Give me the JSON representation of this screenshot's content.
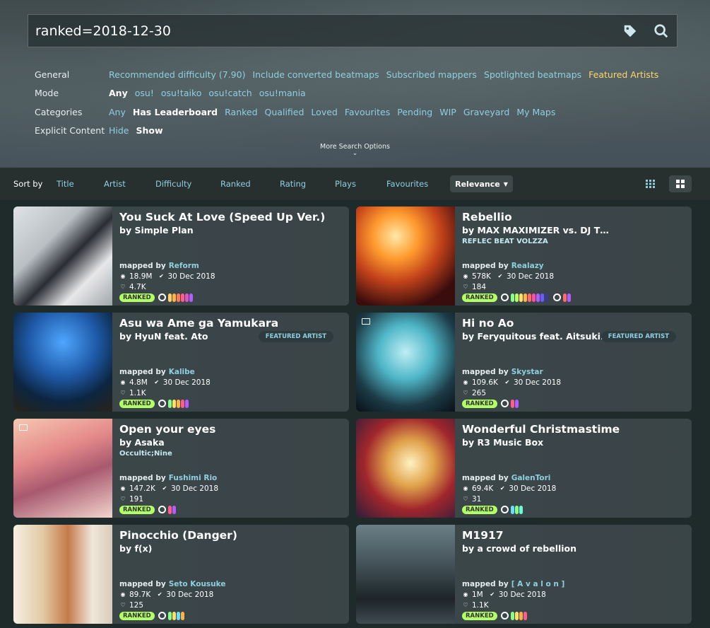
{
  "search": {
    "value": "ranked=2018-12-30"
  },
  "filters": [
    {
      "label": "General",
      "options": [
        {
          "text": "Recommended difficulty (7.90)",
          "state": ""
        },
        {
          "text": "Include converted beatmaps",
          "state": ""
        },
        {
          "text": "Subscribed mappers",
          "state": ""
        },
        {
          "text": "Spotlighted beatmaps",
          "state": ""
        },
        {
          "text": "Featured Artists",
          "state": "featured"
        }
      ]
    },
    {
      "label": "Mode",
      "options": [
        {
          "text": "Any",
          "state": "active"
        },
        {
          "text": "osu!",
          "state": ""
        },
        {
          "text": "osu!taiko",
          "state": ""
        },
        {
          "text": "osu!catch",
          "state": ""
        },
        {
          "text": "osu!mania",
          "state": ""
        }
      ]
    },
    {
      "label": "Categories",
      "options": [
        {
          "text": "Any",
          "state": ""
        },
        {
          "text": "Has Leaderboard",
          "state": "active"
        },
        {
          "text": "Ranked",
          "state": ""
        },
        {
          "text": "Qualified",
          "state": ""
        },
        {
          "text": "Loved",
          "state": ""
        },
        {
          "text": "Favourites",
          "state": ""
        },
        {
          "text": "Pending",
          "state": ""
        },
        {
          "text": "WIP",
          "state": ""
        },
        {
          "text": "Graveyard",
          "state": ""
        },
        {
          "text": "My Maps",
          "state": ""
        }
      ]
    },
    {
      "label": "Explicit Content",
      "options": [
        {
          "text": "Hide",
          "state": ""
        },
        {
          "text": "Show",
          "state": "active"
        }
      ]
    }
  ],
  "more_options": "More Search Options",
  "sort": {
    "label": "Sort by",
    "options": [
      "Title",
      "Artist",
      "Difficulty",
      "Ranked",
      "Rating",
      "Plays",
      "Favourites"
    ],
    "active": "Relevance"
  },
  "ranked_label": "RANKED",
  "mapped_by_label": "mapped by",
  "featured_label": "FEATURED ARTIST",
  "colors": {
    "accent": "#8ecfe0",
    "featured": "#ffd56a",
    "ranked": "#b3ff66"
  },
  "cards": [
    {
      "title": "You Suck At Love (Speed Up Ver.)",
      "artist": "by Simple Plan",
      "source": "",
      "mapper": "Reform",
      "plays": "18.9M",
      "date": "30 Dec 2018",
      "favs": "4.7K",
      "featured": false,
      "thumb_icon": false,
      "thumb": "linear-gradient(135deg,#dfe3e6 0%,#b9c0c4 35%,#2a2d33 55%,#e8e8ea 75%,#9fa6aa 100%)",
      "diffs": [
        [
          "#ffd166",
          "#ffb347",
          "#ff7a59",
          "#ff5d8f",
          "#e055c4",
          "#b35cff"
        ]
      ]
    },
    {
      "title": "Rebellio",
      "artist": "by MAX MAXIMIZER vs. DJ TOTTO",
      "source": "REFLEC BEAT VOLZZA",
      "mapper": "Realazy",
      "plays": "578K",
      "date": "30 Dec 2018",
      "favs": "184",
      "featured": false,
      "thumb_icon": false,
      "thumb": "radial-gradient(circle at 40% 30%,#ffe9a8 0%,#ff9a2e 25%,#c2421a 50%,#3a0d0d 80%)",
      "diffs": [
        [
          "#88ff88",
          "#b8ff66",
          "#ffe066",
          "#ffb347",
          "#ff6b6b",
          "#ff4fa3",
          "#b35cff",
          "#6b5cff",
          "#3a3a8a"
        ],
        [
          "#ff6b6b",
          "#b35cff"
        ]
      ]
    },
    {
      "title": "Asu wa Ame ga Yamukara",
      "artist": "by HyuN feat. Ato",
      "source": "",
      "mapper": "Kalibe",
      "plays": "4.8M",
      "date": "30 Dec 2018",
      "favs": "1.1K",
      "featured": true,
      "thumb_icon": false,
      "thumb": "radial-gradient(circle at 50% 30%,#4fa6ff 0%,#1f5aa8 40%,#0c2540 70%,#2a2418 100%)",
      "diffs": [
        [
          "#88ff88",
          "#ffe066",
          "#ffb347",
          "#ff5d8f",
          "#b35cff"
        ]
      ]
    },
    {
      "title": "Hi no Ao",
      "artist": "by Feryquitous feat. Aitsuki ...",
      "source": "",
      "mapper": "Skystar",
      "plays": "109.6K",
      "date": "30 Dec 2018",
      "favs": "265",
      "featured": true,
      "thumb_icon": true,
      "thumb": "radial-gradient(circle at 50% 40%,#bfeef5 0%,#4fb7c8 35%,#1c3a46 70%,#081016 100%)",
      "diffs": [
        [
          "#ff5d8f",
          "#b35cff"
        ]
      ]
    },
    {
      "title": "Open your eyes",
      "artist": "by Asaka",
      "source": "Occultic;Nine",
      "mapper": "Fushimi Rio",
      "plays": "147.2K",
      "date": "30 Dec 2018",
      "favs": "191",
      "featured": false,
      "thumb_icon": true,
      "thumb": "linear-gradient(160deg,#f7c7b0 0%,#e48a8a 35%,#a8596f 60%,#f2d4cc 100%)",
      "diffs": [
        [
          "#ff5d8f",
          "#b35cff"
        ]
      ]
    },
    {
      "title": "Wonderful Christmastime",
      "artist": "by R3 Music Box",
      "source": "",
      "mapper": "GalenTori",
      "plays": "69.4K",
      "date": "30 Dec 2018",
      "favs": "31",
      "featured": false,
      "thumb_icon": false,
      "thumb": "radial-gradient(circle at 55% 45%,#fff1c2 0%,#e0a24a 30%,#a0262c 60%,#2d1e3a 100%)",
      "diffs": [
        [
          "#66e0ff",
          "#88ff88",
          "#66ffd1"
        ]
      ]
    },
    {
      "title": "Pinocchio (Danger)",
      "artist": "by f(x)",
      "source": "",
      "mapper": "Seto Kousuke",
      "plays": "89.7K",
      "date": "30 Dec 2018",
      "favs": "125",
      "featured": false,
      "thumb_icon": false,
      "thumb": "linear-gradient(90deg,#f6efe2 0%,#e2c9a4 30%,#c47a4a 55%,#f0e8dc 80%,#d8cbb8 100%)",
      "diffs": [
        [
          "#88ff88",
          "#ffe066",
          "#66e0ff",
          "#ffb347"
        ]
      ]
    },
    {
      "title": "M1917",
      "artist": "by a crowd of rebellion",
      "source": "",
      "mapper": "[ A v a l o n ]",
      "plays": "1M",
      "date": "30 Dec 2018",
      "favs": "1.1K",
      "featured": false,
      "thumb_icon": false,
      "thumb": "linear-gradient(180deg,#6a7f86 0%,#3e4c52 45%,#1c2428 75%,#3f4a52 100%)",
      "diffs": [
        [
          "#88ff88",
          "#ffe066",
          "#ffb347",
          "#ff5d8f"
        ]
      ]
    }
  ]
}
